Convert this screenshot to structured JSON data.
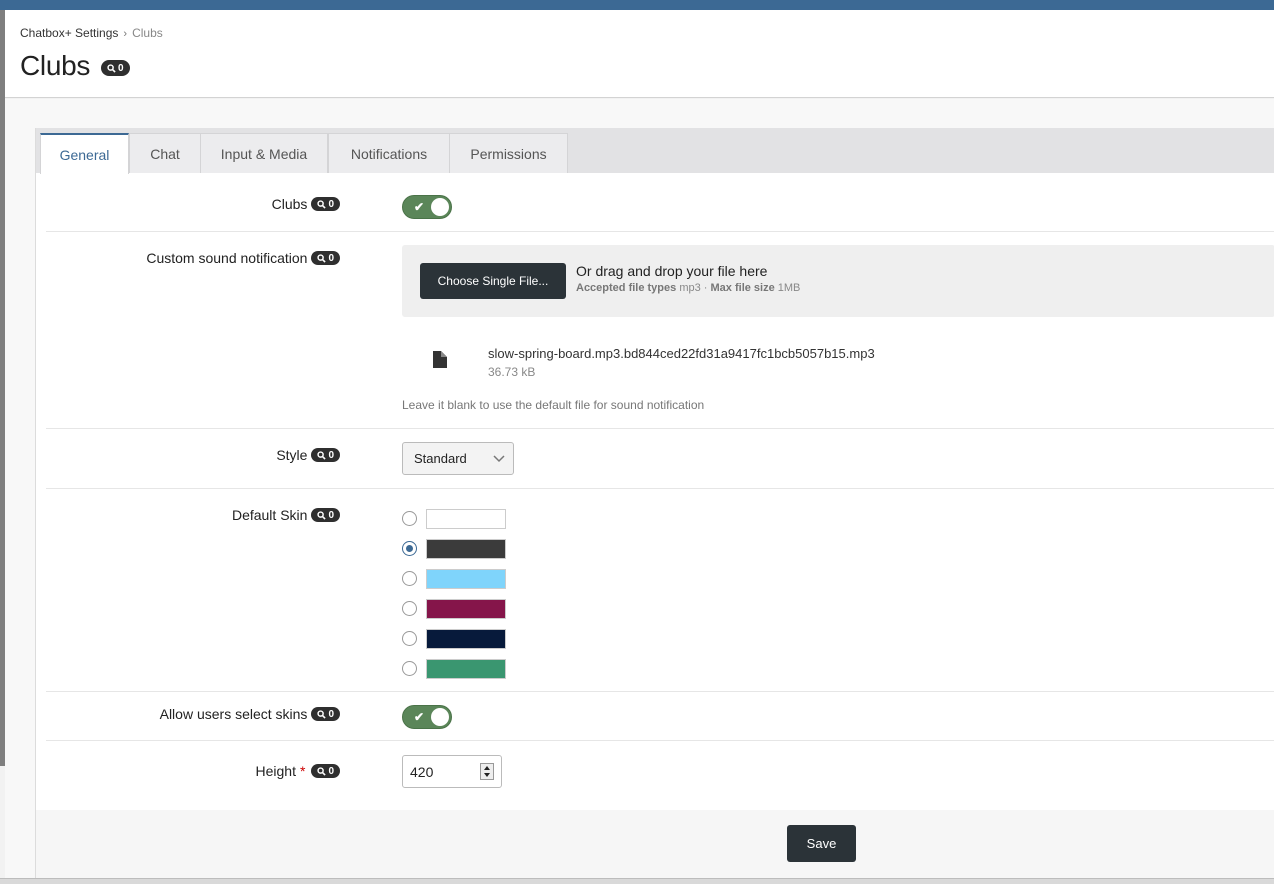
{
  "breadcrumb": {
    "parent": "Chatbox+ Settings",
    "separator": "›",
    "current": "Clubs"
  },
  "page": {
    "title": "Clubs",
    "badge_count": "0"
  },
  "tabs": [
    {
      "label": "General",
      "active": true
    },
    {
      "label": "Chat"
    },
    {
      "label": "Input & Media"
    },
    {
      "label": "Notifications"
    },
    {
      "label": "Permissions"
    }
  ],
  "fields": {
    "clubs": {
      "label": "Clubs",
      "badge": "0",
      "enabled": true
    },
    "custom_sound": {
      "label": "Custom sound notification",
      "badge": "0",
      "choose_button": "Choose Single File...",
      "drag_text": "Or drag and drop your file here",
      "accepted_label": "Accepted file types",
      "accepted_value": "mp3",
      "meta_separator": " · ",
      "max_label": "Max file size",
      "max_value": "1MB",
      "file_name": "slow-spring-board.mp3.bd844ced22fd31a9417fc1bcb5057b15.mp3",
      "file_size": "36.73 kB",
      "hint": "Leave it blank to use the default file for sound notification"
    },
    "style": {
      "label": "Style",
      "badge": "0",
      "value": "Standard"
    },
    "default_skin": {
      "label": "Default Skin",
      "badge": "0",
      "selected_index": 1,
      "swatches": [
        "#ffffff",
        "#3b3b3b",
        "#7fd4fb",
        "#85154a",
        "#071a3b",
        "#3a9670"
      ]
    },
    "allow_skins": {
      "label": "Allow users select skins",
      "badge": "0",
      "enabled": true
    },
    "height": {
      "label": "Height",
      "required_mark": "*",
      "badge": "0",
      "value": "420"
    }
  },
  "actions": {
    "save": "Save"
  },
  "colors": {
    "accent": "#3c6994",
    "toggle_on": "#5b8659",
    "dark_button": "#2b3338"
  }
}
